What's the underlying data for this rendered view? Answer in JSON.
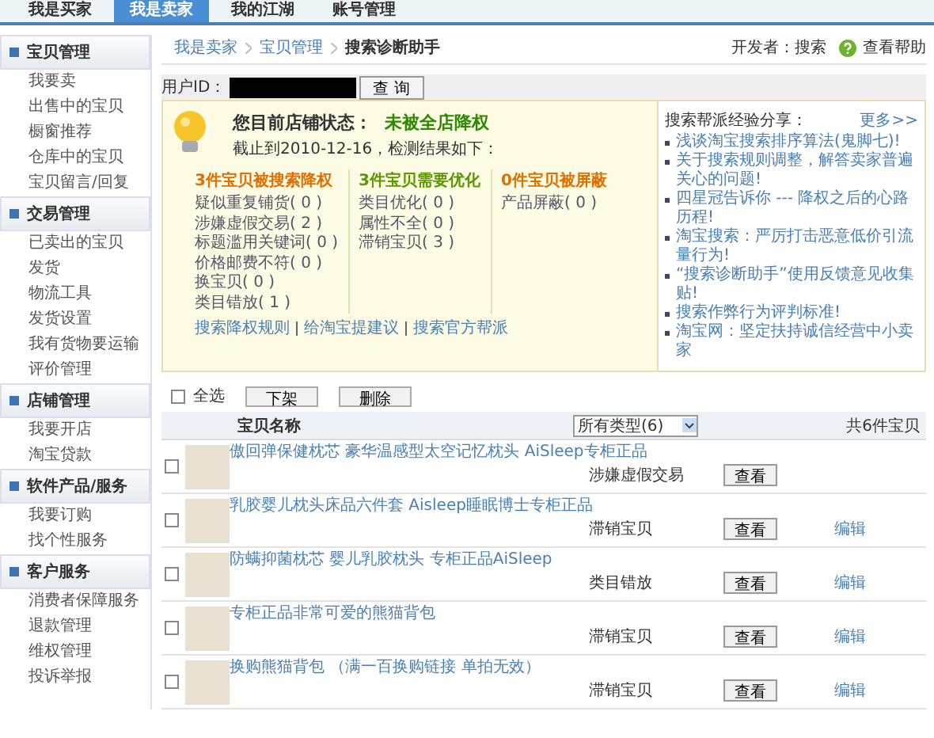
{
  "top_tabs": [
    {
      "label": "我是买家",
      "selected": false
    },
    {
      "label": "我是卖家",
      "selected": true
    },
    {
      "label": "我的江湖",
      "selected": false
    },
    {
      "label": "账号管理",
      "selected": false
    }
  ],
  "sidebar": [
    {
      "title": "宝贝管理",
      "items": [
        "我要卖",
        "出售中的宝贝",
        "橱窗推荐",
        "仓库中的宝贝",
        "宝贝留言/回复"
      ]
    },
    {
      "title": "交易管理",
      "items": [
        "已卖出的宝贝",
        "发货",
        "物流工具",
        "发货设置",
        "我有货物要运输",
        "评价管理"
      ]
    },
    {
      "title": "店铺管理",
      "items": [
        "我要开店",
        "淘宝贷款"
      ]
    },
    {
      "title": "软件产品/服务",
      "items": [
        "我要订购",
        "找个性服务"
      ]
    },
    {
      "title": "客户服务",
      "items": [
        "消费者保障服务",
        "退款管理",
        "维权管理",
        "投诉举报"
      ]
    }
  ],
  "breadcrumb": [
    "我是卖家",
    "宝贝管理",
    "搜索诊断助手"
  ],
  "developer": "开发者：搜索",
  "help_link": "查看帮助",
  "user_id": {
    "label": "用户ID：",
    "button": "查 询"
  },
  "status": {
    "label": "您目前店铺状态：",
    "value": "未被全店降权",
    "date_line": "截止到2010-12-16，检测结果如下：",
    "groups": [
      {
        "title": "3件宝贝被搜索降权",
        "color": "#e07000",
        "items": [
          "疑似重复铺货( 0 )",
          "涉嫌虚假交易( 2 )",
          "标题滥用关键词( 0 )",
          "价格邮费不符( 0 )",
          "换宝贝( 0 )",
          "类目错放( 1 )"
        ]
      },
      {
        "title": "3件宝贝需要优化",
        "color": "#5a9a00",
        "items": [
          "类目优化( 0 )",
          "属性不全( 0 )",
          "滞销宝贝( 3 )"
        ]
      },
      {
        "title": "0件宝贝被屏蔽",
        "color": "#e07000",
        "items": [
          "产品屏蔽( 0 )"
        ]
      }
    ],
    "links": [
      "搜索降权规则",
      "给淘宝提建议",
      "搜索官方帮派"
    ]
  },
  "tips": {
    "title": "搜索帮派经验分享：",
    "more": "更多>>",
    "items": [
      "浅谈淘宝搜索排序算法(鬼脚七)!",
      "关于搜索规则调整，解答卖家普遍关心的问题!",
      "四星冠告诉你 --- 降权之后的心路历程!",
      "淘宝搜索：严厉打击恶意低价引流量行为!",
      "“搜索诊断助手”使用反馈意见收集贴!",
      "搜索作弊行为评判标准!",
      "淘宝网：坚定扶持诚信经营中小卖家"
    ]
  },
  "toolbar": {
    "select_all": "全选",
    "select_all_checked": false,
    "buttons": [
      "下架",
      "删除"
    ]
  },
  "table": {
    "column_name": "宝贝名称",
    "filter": "所有类型(6)",
    "total": "共6件宝贝",
    "rows": [
      {
        "checked": false,
        "title": "傲回弹保健枕芯 豪华温感型太空记忆枕头 AiSleep专柜正品",
        "type": "涉嫌虚假交易",
        "view": "查看"
      },
      {
        "checked": false,
        "title": "乳胶婴儿枕头床品六件套 Aisleep睡眠博士专柜正品",
        "type": "滞销宝贝",
        "view": "查看",
        "edit": "编辑"
      },
      {
        "checked": false,
        "title": "防螨抑菌枕芯 婴儿乳胶枕头 专柜正品AiSleep",
        "type": "类目错放",
        "view": "查看",
        "edit": "编辑"
      },
      {
        "checked": false,
        "title": "专柜正品非常可爱的熊猫背包",
        "type": "滞销宝贝",
        "view": "查看",
        "edit": "编辑"
      },
      {
        "checked": false,
        "title": "换购熊猫背包 （满一百换购链接 单拍无效）",
        "type": "滞销宝贝",
        "view": "查看",
        "edit": "编辑"
      }
    ]
  }
}
